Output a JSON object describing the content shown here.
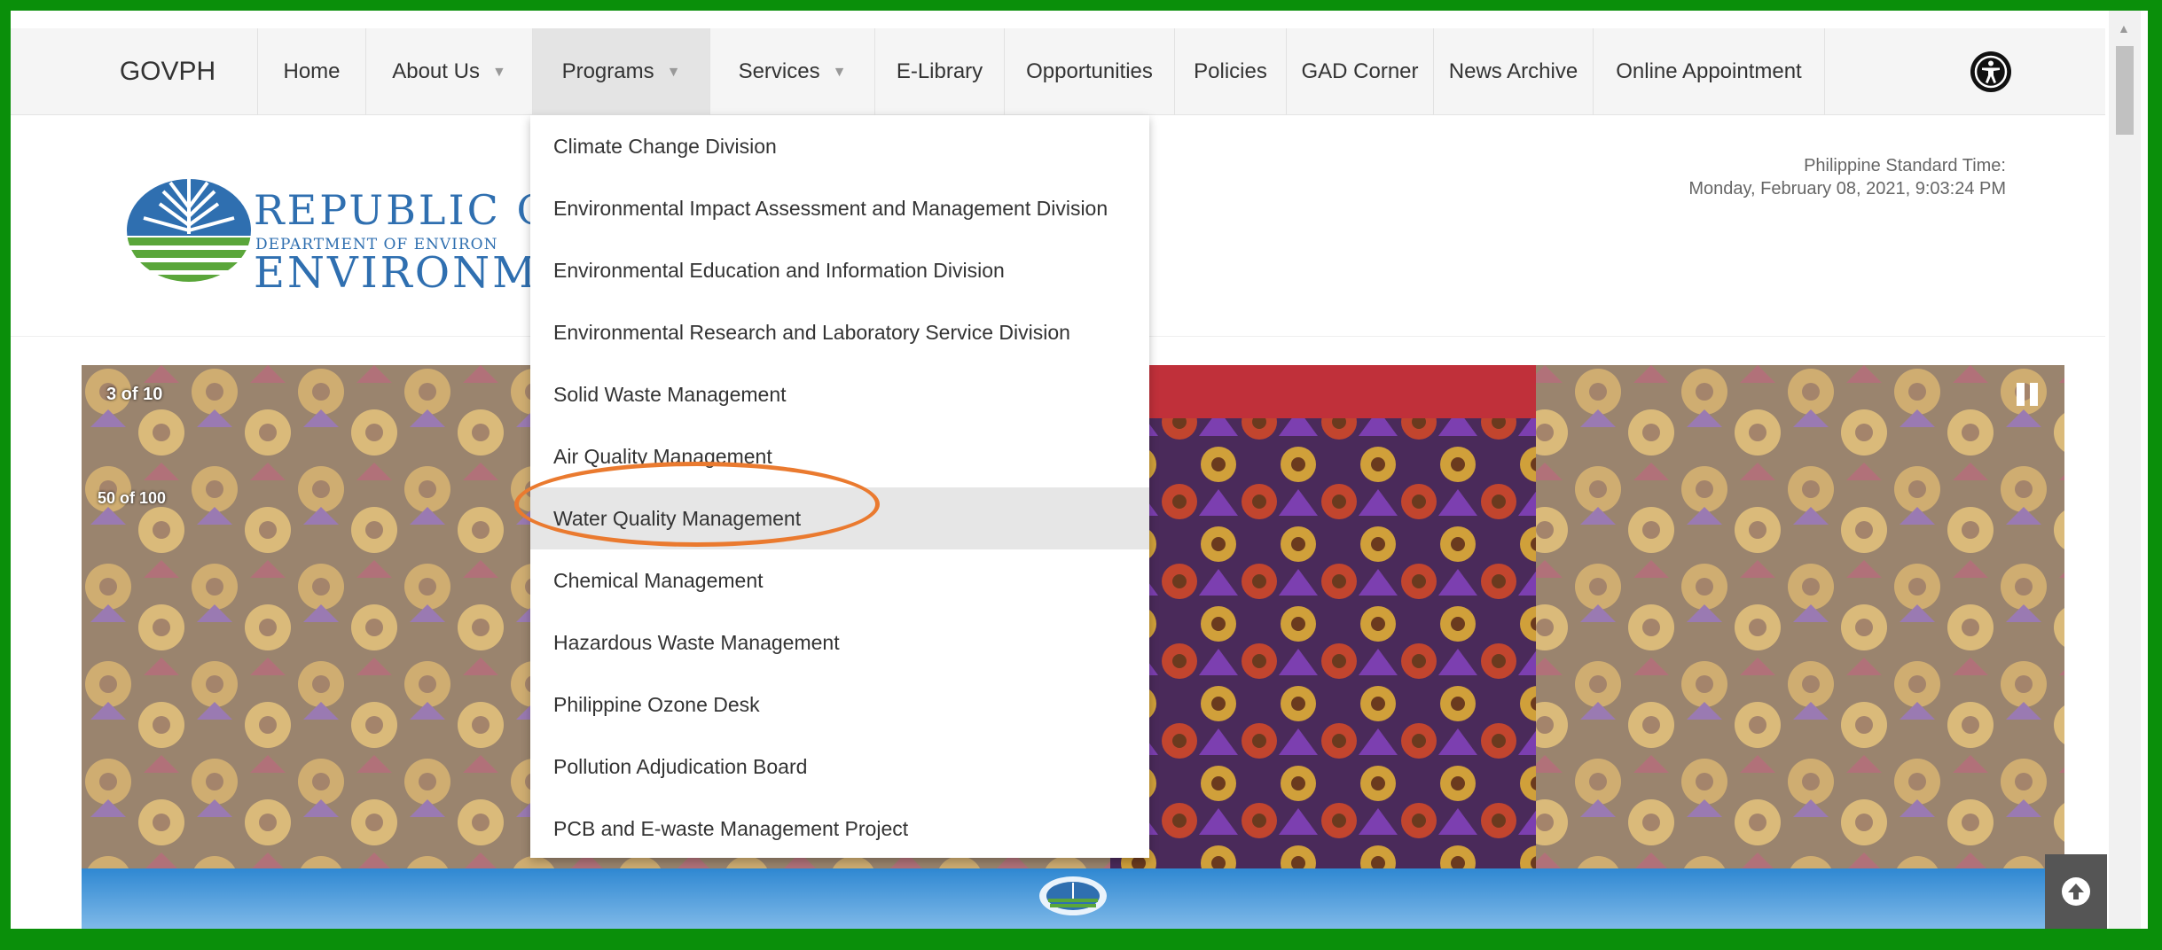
{
  "nav": {
    "brand": "GOVPH",
    "items": [
      {
        "label": "Home"
      },
      {
        "label": "About Us"
      },
      {
        "label": "Programs"
      },
      {
        "label": "Services"
      },
      {
        "label": "E-Library"
      },
      {
        "label": "Opportunities"
      },
      {
        "label": "Policies"
      },
      {
        "label": "GAD Corner"
      },
      {
        "label": "News Archive"
      },
      {
        "label": "Online Appointment"
      }
    ],
    "caret": "▼",
    "accessibility_icon": "accessibility-icon"
  },
  "header": {
    "logo_line1": "REPUBLIC OF T",
    "logo_line2": "DEPARTMENT OF ENVIRON",
    "logo_line3": "ENVIRONMENT",
    "pst_label": "Philippine Standard Time:",
    "pst_value": "Monday, February 08, 2021, 9:03:24 PM"
  },
  "slideshow": {
    "counter": "3 of 10",
    "secondary_counter": "50 of 100",
    "pause_icon": "pause-icon"
  },
  "dropdown": {
    "items": [
      {
        "label": "Climate Change Division"
      },
      {
        "label": "Environmental Impact Assessment and Management Division"
      },
      {
        "label": "Environmental Education and Information Division"
      },
      {
        "label": "Environmental Research and Laboratory Service Division"
      },
      {
        "label": "Solid Waste Management"
      },
      {
        "label": "Air Quality Management"
      },
      {
        "label": "Water Quality Management"
      },
      {
        "label": "Chemical Management"
      },
      {
        "label": "Hazardous Waste Management"
      },
      {
        "label": "Philippine Ozone Desk"
      },
      {
        "label": "Pollution Adjudication Board"
      },
      {
        "label": "PCB and E-waste Management Project"
      }
    ],
    "highlighted_item": "Water Quality Management"
  },
  "colors": {
    "frame": "#0a8f0a",
    "highlight_ring": "#ea7a2f",
    "logo_blue": "#2f6fb0",
    "logo_green": "#5aa63a"
  }
}
